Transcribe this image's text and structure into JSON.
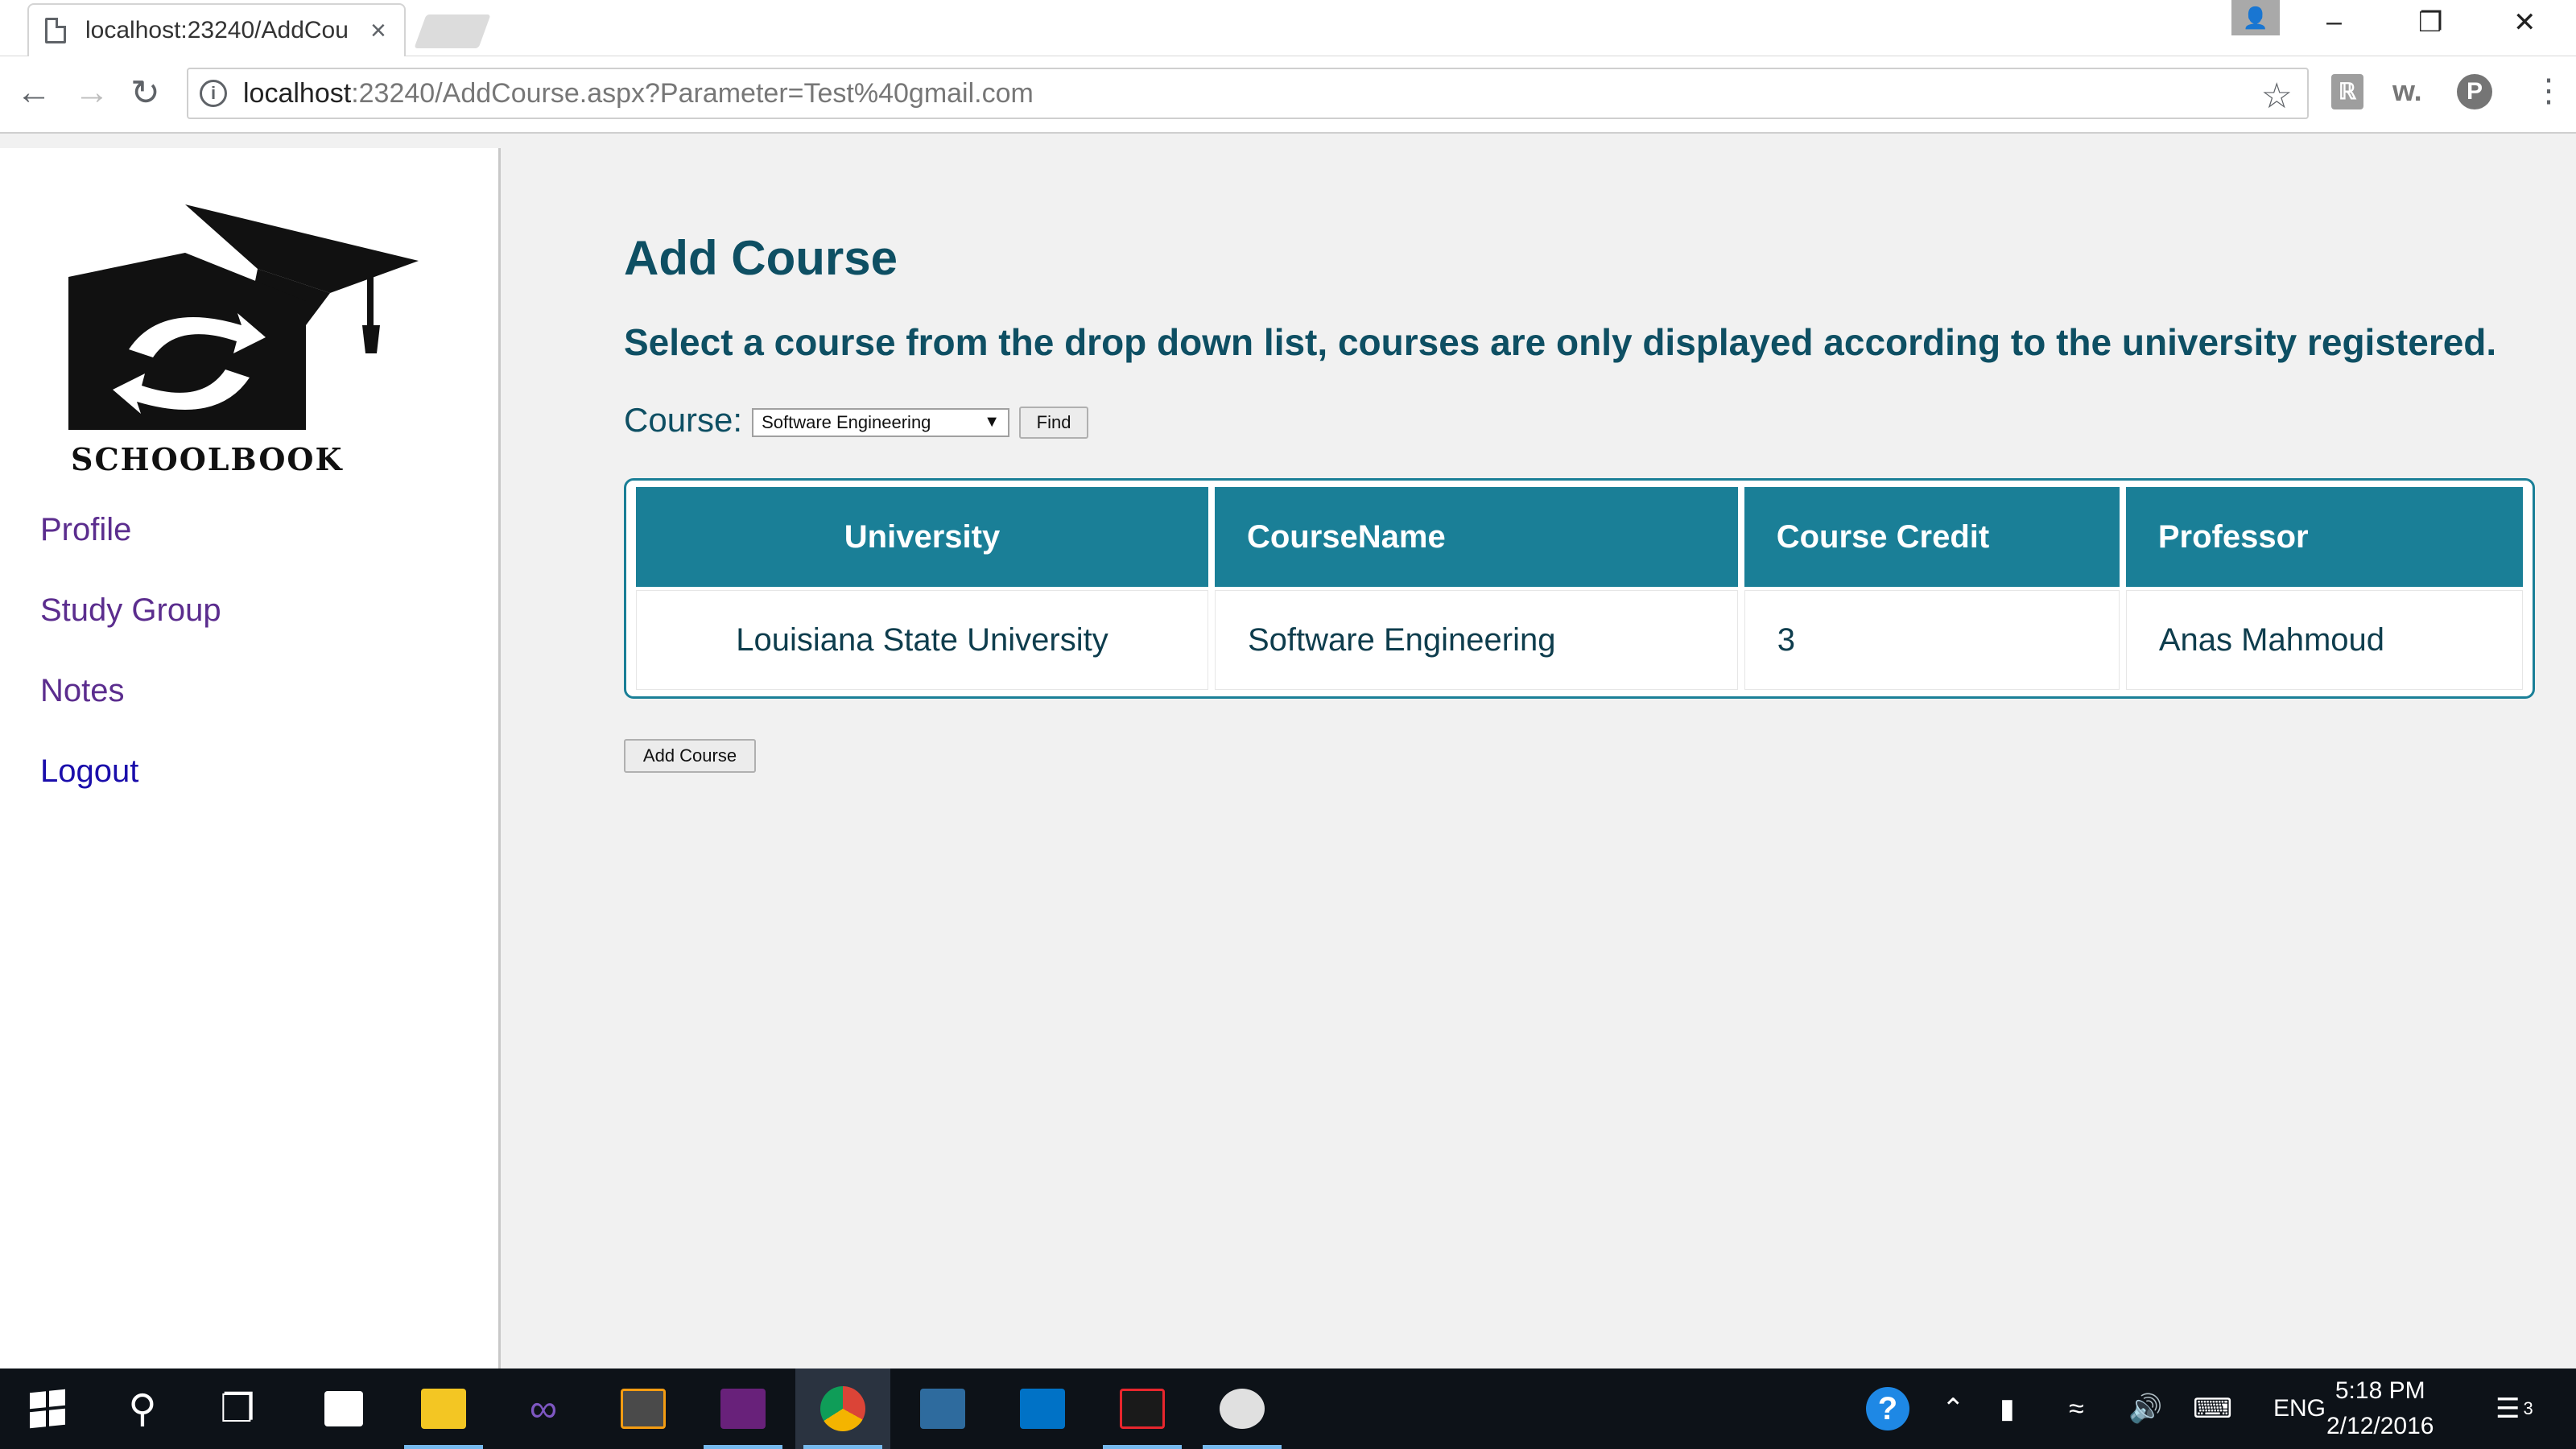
{
  "browser": {
    "tab_title": "localhost:23240/AddCou",
    "tab_close": "×",
    "url_host": "localhost",
    "url_rest": ":23240/AddCourse.aspx?Parameter=Test%40gmail.com",
    "window_avatar": "👤",
    "ext1": "ℝ",
    "ext2": "w.",
    "ext3": "P"
  },
  "sidebar": {
    "logo_text": "SCHOOLBOOK",
    "links": [
      {
        "label": "Profile"
      },
      {
        "label": "Study Group"
      },
      {
        "label": "Notes"
      },
      {
        "label": "Logout"
      }
    ]
  },
  "main": {
    "title": "Add Course",
    "instructions": "Select a course from the drop down list, courses are only displayed according to the university registered.",
    "course_label": "Course:",
    "course_selected": "Software Engineering",
    "find_label": "Find",
    "table": {
      "headers": [
        "University",
        "CourseName",
        "Course Credit",
        "Professor"
      ],
      "rows": [
        [
          "Louisiana State University",
          "Software Engineering",
          "3",
          "Anas Mahmoud"
        ]
      ]
    },
    "add_course_label": "Add Course"
  },
  "taskbar": {
    "language": "ENG",
    "time": "5:18 PM",
    "date": "2/12/2016",
    "notification_count": "3"
  },
  "colors": {
    "accent": "#1a7f97",
    "heading": "#0e4f63",
    "visited_link": "#5b2d8e",
    "link": "#1a0dab"
  }
}
